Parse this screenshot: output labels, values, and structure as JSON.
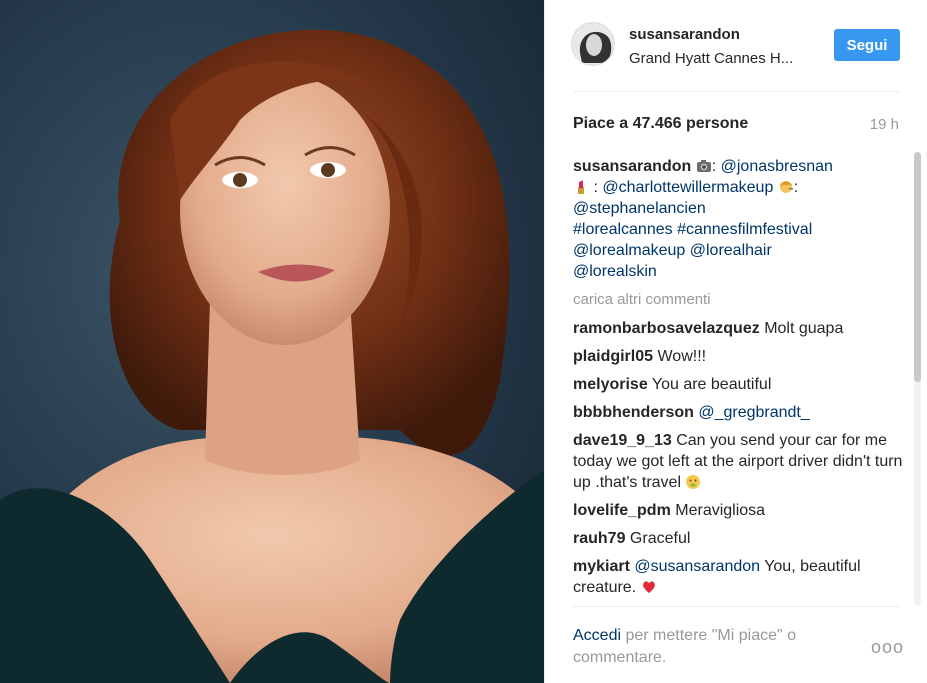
{
  "post": {
    "username": "susansarandon",
    "location": "Grand Hyatt Cannes H...",
    "follow_label": "Segui",
    "likes_text": "Piace a 47.466 persone",
    "time": "19 h"
  },
  "caption": {
    "username": "susansarandon",
    "seg1_tag": "@jonasbresnan",
    "seg2_tag": "@charlottewillermakeup",
    "seg3_tag": "@stephanelancien",
    "seg4": "#lorealcannes #cannesfilmfestival",
    "seg5": "@lorealmakeup @lorealhair",
    "seg6": "@lorealskin",
    "colon": ":"
  },
  "load_more": "carica altri commenti",
  "comments": [
    {
      "user": "ramonbarbosavelazquez",
      "text": "Molt guapa"
    },
    {
      "user": "plaidgirl05",
      "text": "Wow!!!"
    },
    {
      "user": "melyorise",
      "text": "You are beautiful"
    },
    {
      "user": "bbbbhenderson",
      "text": "@_gregbrandt_"
    },
    {
      "user": "dave19_9_13",
      "text": "Can you send your car for me today we got left at the airport driver didn't turn up .that's travel"
    },
    {
      "user": "lovelife_pdm",
      "text": "Meravigliosa"
    },
    {
      "user": "rauh79",
      "text": "Graceful"
    },
    {
      "user": "mykiart",
      "text_tag": "@susansarandon",
      "text": "You, beautiful creature."
    }
  ],
  "footer": {
    "login": "Accedi",
    "rest": "per mettere \"Mi piace\" o commentare.",
    "more": "ooo"
  },
  "colors": {
    "accent": "#3897f0",
    "link": "#003569",
    "muted": "#999999"
  },
  "icons": [
    "camera-emoji",
    "lipstick-emoji",
    "haircut-emoji",
    "sick-face-emoji",
    "red-heart-emoji"
  ]
}
